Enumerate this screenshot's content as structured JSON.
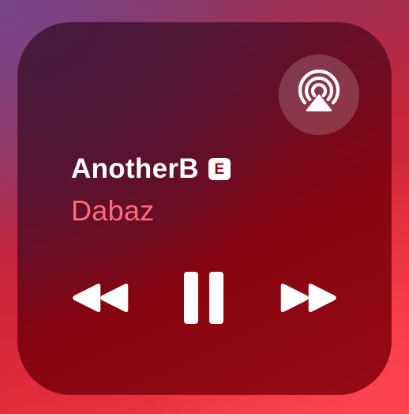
{
  "now_playing": {
    "title": "AnotherB",
    "explicit_badge": "E",
    "artist": "Dabaz"
  },
  "controls": {
    "airplay_icon": "airplay-audio-icon",
    "rewind_icon": "rewind-icon",
    "pause_icon": "pause-icon",
    "forward_icon": "fast-forward-icon",
    "playback_state": "playing"
  },
  "colors": {
    "title": "#ffffff",
    "artist": "#ff6b78",
    "widget_background": "#860510",
    "icon": "#ffffff"
  }
}
